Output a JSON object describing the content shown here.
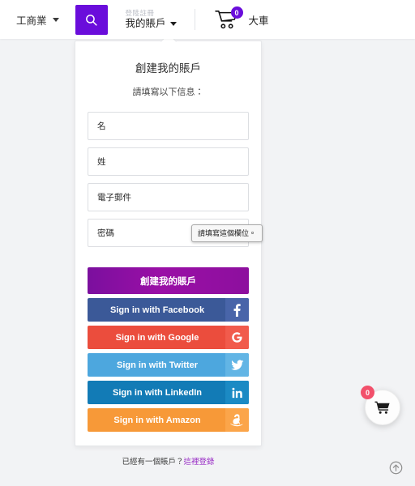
{
  "header": {
    "category_label": "工商業",
    "category_caret_icon": "chevron-down-icon",
    "search_icon": "search-icon",
    "account_top_label": "登陸註冊",
    "account_main_label": "我的賬戶",
    "account_caret_icon": "chevron-down-icon",
    "cart_icon": "shopping-cart-icon",
    "cart_count": "0",
    "cart_label": "大車"
  },
  "panel": {
    "title": "創建我的賬戶",
    "subtitle": "請填寫以下信息：",
    "fields": [
      {
        "name": "first-name",
        "placeholder": "名",
        "value": ""
      },
      {
        "name": "last-name",
        "placeholder": "姓",
        "value": ""
      },
      {
        "name": "email",
        "placeholder": "電子郵件",
        "value": ""
      },
      {
        "name": "password",
        "placeholder": "密碼",
        "value": ""
      }
    ],
    "validation_tooltip": "請填寫這個欄位。",
    "submit_label": "創建我的賬戶",
    "social_buttons": [
      {
        "label": "Sign in with Facebook",
        "icon": "facebook-icon",
        "glyph": "f",
        "color": "#3b5998"
      },
      {
        "label": "Sign in with Google",
        "icon": "google-icon",
        "glyph": "G",
        "color": "#eb4d3d"
      },
      {
        "label": "Sign in with Twitter",
        "icon": "twitter-icon",
        "glyph": "✉",
        "color": "#4da7de"
      },
      {
        "label": "Sign in with LinkedIn",
        "icon": "linkedin-icon",
        "glyph": "in",
        "color": "#127bb6"
      },
      {
        "label": "Sign in with Amazon",
        "icon": "amazon-icon",
        "glyph": "a",
        "color": "#f79938"
      }
    ],
    "footer_text": "已經有一個賬戶？",
    "footer_link": "這裡登錄"
  },
  "floating": {
    "cart_icon": "shopping-cart-icon",
    "cart_count": "0",
    "to_top_icon": "arrow-up-circle-icon"
  },
  "colors": {
    "brand_purple": "#6a0ddb",
    "submit_gradient_start": "#7b0f9e",
    "submit_gradient_end": "#8d0f9e",
    "link_purple": "#9a2fc6",
    "badge_red": "#f2506b",
    "page_background": "#f2f3f5"
  }
}
